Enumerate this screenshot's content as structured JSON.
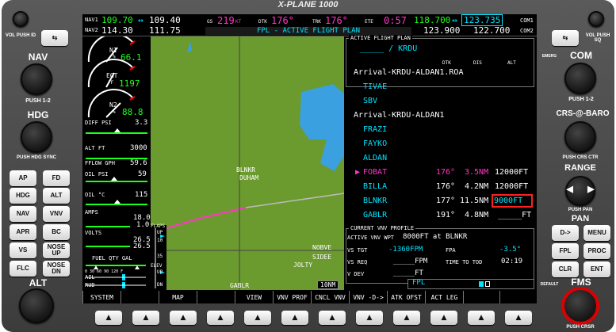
{
  "window_title": "X-PLANE 1000",
  "left_panel": {
    "vol_push_id": "VOL PUSH ID",
    "swap_icon": "swap-icon",
    "nav_label": "NAV",
    "push_12_label": "PUSH 1-2",
    "hdg_label": "HDG",
    "push_hdg_sync_label": "PUSH HDG SYNC",
    "keys": [
      "AP",
      "FD",
      "HDG",
      "ALT",
      "NAV",
      "VNV",
      "APR",
      "BC",
      "VS",
      "NOSE UP",
      "FLC",
      "NOSE DN"
    ],
    "alt_label": "ALT"
  },
  "right_panel": {
    "vol_push_sq": "VOL PUSH SQ",
    "emerg_label": "EMERG",
    "com_label": "COM",
    "push_12_label": "PUSH 1-2",
    "crs_baro_label": "CRS-@-BARO",
    "push_crs_ctr_label": "PUSH CRS CTR",
    "range_label": "RANGE",
    "push_pan_label": "PUSH PAN",
    "pan_label": "PAN",
    "keys": [
      "D->",
      "MENU",
      "FPL",
      "PROC",
      "CLR",
      "ENT"
    ],
    "default_label": "DEFAULT",
    "fms_label": "FMS",
    "push_crsr_label": "PUSH CRSR"
  },
  "top_bar": {
    "nav1_label": "NAV1",
    "nav1_active": "109.70",
    "nav1_arrow": "↔",
    "nav1_standby": "109.40",
    "nav2_label": "NAV2",
    "nav2_active": "114.30",
    "nav2_standby": "111.75",
    "gs_label": "GS",
    "gs_value": "219",
    "gs_unit": "KT",
    "dtk_label": "DTK",
    "dtk_value": "176°",
    "trk_label": "TRK",
    "trk_value": "176°",
    "ete_label": "ETE",
    "ete_value": "0:57",
    "com1_active": "118.700",
    "com1_arrow": "↔",
    "com1_standby": "123.735",
    "com1_label": "COM1",
    "com2_active": "123.900",
    "com2_standby": "122.700",
    "com2_label": "COM2",
    "page_title": "FPL - ACTIVE FLIGHT PLAN"
  },
  "engine": {
    "n1_label": "N1",
    "n1_unit": "%",
    "n1_value": "66.1",
    "egt_label": "EGT",
    "egt_unit": "°F",
    "egt_value": "1197",
    "n2_label": "N2",
    "n2_unit": "%",
    "n2_value": "88.8",
    "diff_psi_label": "DIFF PSI",
    "diff_psi_value": "3.3",
    "alt_ft_label": "ALT FT",
    "alt_ft_value": "3000",
    "fflow_label": "FFLOW GPH",
    "fflow_value": "59.6",
    "oil_psi_label": "OIL PSI",
    "oil_psi_value": "59",
    "oil_temp_label": "OIL °C",
    "oil_temp_value": "115",
    "amps_label": "AMPS",
    "amps_value1": "18.0",
    "amps_value2": "1.0",
    "volts_label": "VOLTS",
    "volts_value1": "26.5",
    "volts_value2": "26.5",
    "fuel_label": "FUEL QTY GAL",
    "fuel_ticks": "0  30  60  90  120  F",
    "ail_label": "AIL",
    "rud_label": "RUD",
    "flaps_label": "FLAPS",
    "flaps_up": "UP",
    "flaps_10": "10",
    "flaps_35": "35",
    "elev_label": "ELEV",
    "elev_up": "UP",
    "elev_dn": "DN"
  },
  "map": {
    "labels": [
      {
        "text": "BLNKR",
        "name": "map-label-blnkr"
      },
      {
        "text": "DUHAM",
        "name": "map-label-duham"
      },
      {
        "text": "NOBVE",
        "name": "map-label-nobve"
      },
      {
        "text": "SIDEE",
        "name": "map-label-sidee"
      },
      {
        "text": "JOLTY",
        "name": "map-label-jolty"
      },
      {
        "text": "GABLR",
        "name": "map-label-gablr"
      }
    ],
    "range": "10NM"
  },
  "fpl": {
    "header": "ACTIVE FLIGHT PLAN",
    "route": "_____ / KRDU",
    "col_dtk": "DTK",
    "col_dis": "DIS",
    "col_alt": "ALT",
    "rows": [
      {
        "name": "Arrival-KRDU-ALDAN1.ROA",
        "type": "header"
      },
      {
        "name": "TIVAE",
        "type": "wpt",
        "dtk": "",
        "dis": "",
        "alt": ""
      },
      {
        "name": "SBV",
        "type": "wpt",
        "dtk": "",
        "dis": "",
        "alt": ""
      },
      {
        "name": "Arrival-KRDU-ALDAN1",
        "type": "header"
      },
      {
        "name": "FRAZI",
        "type": "wpt",
        "dtk": "",
        "dis": "",
        "alt": ""
      },
      {
        "name": "FAYKO",
        "type": "wpt",
        "dtk": "",
        "dis": "",
        "alt": ""
      },
      {
        "name": "ALDAN",
        "type": "wpt",
        "dtk": "",
        "dis": "",
        "alt": ""
      },
      {
        "name": "FOBAT",
        "type": "active",
        "dtk": "176°",
        "dis": "3.5NM",
        "alt": "12000FT"
      },
      {
        "name": "BILLA",
        "type": "wpt",
        "dtk": "176°",
        "dis": "4.2NM",
        "alt": "12000FT"
      },
      {
        "name": "BLNKR",
        "type": "wpt",
        "dtk": "177°",
        "dis": "11.5NM",
        "alt": "9000FT"
      },
      {
        "name": "GABLR",
        "type": "wpt",
        "dtk": "191°",
        "dis": "4.8NM",
        "alt": "_____FT"
      }
    ],
    "vnv_header": "CURRENT VNV PROFILE",
    "active_vnv_label": "ACTIVE VNV WPT",
    "active_vnv_value": "8000FT at BLNKR",
    "vs_tgt_label": "VS TGT",
    "vs_tgt_value": "-1360FPM",
    "fpa_label": "FPA",
    "fpa_value": "-3.5°",
    "vs_req_label": "VS REQ",
    "vs_req_value": "_____FPM",
    "time_tod_label": "TIME TO TOD",
    "time_tod_value": "02:19",
    "v_dev_label": "V DEV",
    "v_dev_value": "_____FT",
    "footer_label": "FPL"
  },
  "softkeys": [
    "SYSTEM",
    "",
    "MAP",
    "",
    "VIEW",
    "VNV PROF",
    "CNCL VNV",
    "VNV -D->",
    "ATK OFST",
    "ACT LEG",
    "",
    ""
  ],
  "colors": {
    "cyan": "#00e5ff",
    "magenta": "#ff36c8",
    "green": "#1cff1c",
    "map_land": "#6b9a2e",
    "water": "#3aa0e0",
    "highlight_box": "#ff2020"
  }
}
